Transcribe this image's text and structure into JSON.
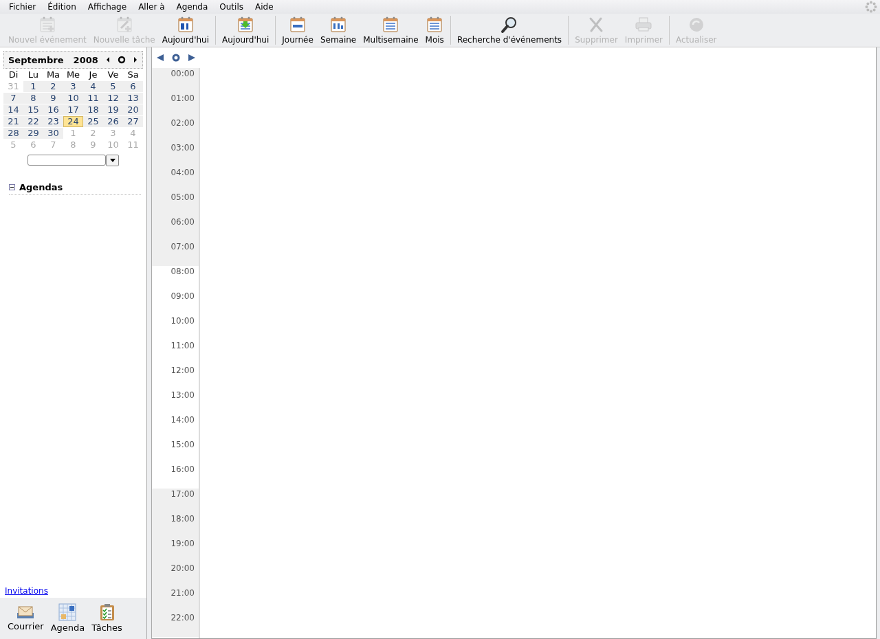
{
  "menu": [
    {
      "label": "Fichier"
    },
    {
      "label": "Édition"
    },
    {
      "label": "Affichage"
    },
    {
      "label": "Aller à"
    },
    {
      "label": "Agenda"
    },
    {
      "label": "Outils"
    },
    {
      "label": "Aide"
    }
  ],
  "toolbar": [
    {
      "kind": "button",
      "label": "Nouvel événement",
      "disabled": true
    },
    {
      "kind": "button",
      "label": "Nouvelle tâche",
      "disabled": true
    },
    {
      "kind": "button",
      "label": "Aujourd'hui",
      "disabled": false
    },
    {
      "kind": "separator"
    },
    {
      "kind": "button",
      "label": "Aujourd'hui",
      "disabled": false
    },
    {
      "kind": "separator"
    },
    {
      "kind": "button",
      "label": "Journée",
      "disabled": false
    },
    {
      "kind": "button",
      "label": "Semaine",
      "disabled": false
    },
    {
      "kind": "button",
      "label": "Multisemaine",
      "disabled": false
    },
    {
      "kind": "button",
      "label": "Mois",
      "disabled": false
    },
    {
      "kind": "separator"
    },
    {
      "kind": "button",
      "label": "Recherche d'événements",
      "disabled": false
    },
    {
      "kind": "separator"
    },
    {
      "kind": "button",
      "label": "Supprimer",
      "disabled": true
    },
    {
      "kind": "button",
      "label": "Imprimer",
      "disabled": true
    },
    {
      "kind": "separator"
    },
    {
      "kind": "button",
      "label": "Actualiser",
      "disabled": true
    }
  ],
  "minimonth": {
    "month": "Septembre",
    "year": "2008",
    "weekdays": [
      "Di",
      "Lu",
      "Ma",
      "Me",
      "Je",
      "Ve",
      "Sa"
    ],
    "weeks": [
      [
        {
          "day": "31",
          "in_month": false,
          "selected": false
        },
        {
          "day": "1",
          "in_month": true,
          "selected": false
        },
        {
          "day": "2",
          "in_month": true,
          "selected": false
        },
        {
          "day": "3",
          "in_month": true,
          "selected": false
        },
        {
          "day": "4",
          "in_month": true,
          "selected": false
        },
        {
          "day": "5",
          "in_month": true,
          "selected": false
        },
        {
          "day": "6",
          "in_month": true,
          "selected": false
        }
      ],
      [
        {
          "day": "7",
          "in_month": true,
          "selected": false
        },
        {
          "day": "8",
          "in_month": true,
          "selected": false
        },
        {
          "day": "9",
          "in_month": true,
          "selected": false
        },
        {
          "day": "10",
          "in_month": true,
          "selected": false
        },
        {
          "day": "11",
          "in_month": true,
          "selected": false
        },
        {
          "day": "12",
          "in_month": true,
          "selected": false
        },
        {
          "day": "13",
          "in_month": true,
          "selected": false
        }
      ],
      [
        {
          "day": "14",
          "in_month": true,
          "selected": false
        },
        {
          "day": "15",
          "in_month": true,
          "selected": false
        },
        {
          "day": "16",
          "in_month": true,
          "selected": false
        },
        {
          "day": "17",
          "in_month": true,
          "selected": false
        },
        {
          "day": "18",
          "in_month": true,
          "selected": false
        },
        {
          "day": "19",
          "in_month": true,
          "selected": false
        },
        {
          "day": "20",
          "in_month": true,
          "selected": false
        }
      ],
      [
        {
          "day": "21",
          "in_month": true,
          "selected": false
        },
        {
          "day": "22",
          "in_month": true,
          "selected": false
        },
        {
          "day": "23",
          "in_month": true,
          "selected": false
        },
        {
          "day": "24",
          "in_month": true,
          "selected": true
        },
        {
          "day": "25",
          "in_month": true,
          "selected": false
        },
        {
          "day": "26",
          "in_month": true,
          "selected": false
        },
        {
          "day": "27",
          "in_month": true,
          "selected": false
        }
      ],
      [
        {
          "day": "28",
          "in_month": true,
          "selected": false
        },
        {
          "day": "29",
          "in_month": true,
          "selected": false
        },
        {
          "day": "30",
          "in_month": true,
          "selected": false
        },
        {
          "day": "1",
          "in_month": false,
          "selected": false
        },
        {
          "day": "2",
          "in_month": false,
          "selected": false
        },
        {
          "day": "3",
          "in_month": false,
          "selected": false
        },
        {
          "day": "4",
          "in_month": false,
          "selected": false
        }
      ],
      [
        {
          "day": "5",
          "in_month": false,
          "selected": false
        },
        {
          "day": "6",
          "in_month": false,
          "selected": false
        },
        {
          "day": "7",
          "in_month": false,
          "selected": false
        },
        {
          "day": "8",
          "in_month": false,
          "selected": false
        },
        {
          "day": "9",
          "in_month": false,
          "selected": false
        },
        {
          "day": "10",
          "in_month": false,
          "selected": false
        },
        {
          "day": "11",
          "in_month": false,
          "selected": false
        }
      ]
    ]
  },
  "agendas": {
    "label": "Agendas",
    "expanded": true
  },
  "invitations_link": "Invitations",
  "modes": [
    {
      "label": "Courrier"
    },
    {
      "label": "Agenda"
    },
    {
      "label": "Tâches"
    }
  ],
  "hours": [
    {
      "time": "00:00",
      "work": false
    },
    {
      "time": "01:00",
      "work": false
    },
    {
      "time": "02:00",
      "work": false
    },
    {
      "time": "03:00",
      "work": false
    },
    {
      "time": "04:00",
      "work": false
    },
    {
      "time": "05:00",
      "work": false
    },
    {
      "time": "06:00",
      "work": false
    },
    {
      "time": "07:00",
      "work": false
    },
    {
      "time": "08:00",
      "work": true
    },
    {
      "time": "09:00",
      "work": true
    },
    {
      "time": "10:00",
      "work": true
    },
    {
      "time": "11:00",
      "work": true
    },
    {
      "time": "12:00",
      "work": true
    },
    {
      "time": "13:00",
      "work": true
    },
    {
      "time": "14:00",
      "work": true
    },
    {
      "time": "15:00",
      "work": true
    },
    {
      "time": "16:00",
      "work": true
    },
    {
      "time": "17:00",
      "work": false
    },
    {
      "time": "18:00",
      "work": false
    },
    {
      "time": "19:00",
      "work": false
    },
    {
      "time": "20:00",
      "work": false
    },
    {
      "time": "21:00",
      "work": false
    },
    {
      "time": "22:00",
      "work": false
    }
  ]
}
